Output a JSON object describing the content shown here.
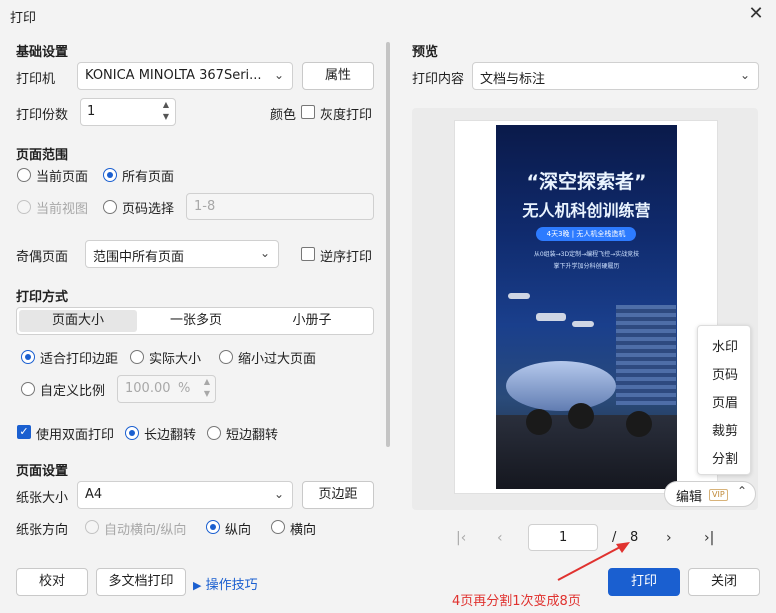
{
  "window": {
    "title": "打印"
  },
  "basic": {
    "section": "基础设置",
    "printer_label": "打印机",
    "printer_value": "KONICA MINOLTA 367Seri...",
    "properties_button": "属性",
    "copies_label": "打印份数",
    "copies_value": "1",
    "color_label": "颜色",
    "grayscale_label": "灰度打印"
  },
  "range": {
    "section": "页面范围",
    "current_page": "当前页面",
    "all_pages": "所有页面",
    "current_view": "当前视图",
    "page_select": "页码选择",
    "page_select_value": "1-8",
    "odd_even_label": "奇偶页面",
    "odd_even_value": "范围中所有页面",
    "reverse_label": "逆序打印"
  },
  "mode": {
    "section": "打印方式",
    "tabs": [
      "页面大小",
      "一张多页",
      "小册子"
    ],
    "fit_margins": "适合打印边距",
    "actual_size": "实际大小",
    "shrink_large": "缩小过大页面",
    "custom_scale": "自定义比例",
    "scale_value": "100.00",
    "scale_unit": "%",
    "duplex": "使用双面打印",
    "long_edge": "长边翻转",
    "short_edge": "短边翻转"
  },
  "page_setup": {
    "section": "页面设置",
    "paper_size_label": "纸张大小",
    "paper_size_value": "A4",
    "margins_button": "页边距",
    "orientation_label": "纸张方向",
    "auto_orientation": "自动横向/纵向",
    "portrait": "纵向",
    "landscape": "横向"
  },
  "footer": {
    "proofread": "校对",
    "multi_doc": "多文档打印",
    "tips": "操作技巧",
    "print": "打印",
    "close": "关闭",
    "annotation": "4页再分割1次变成8页"
  },
  "preview": {
    "section": "预览",
    "content_label": "打印内容",
    "content_value": "文档与标注",
    "poster_title_1": "“深空探索者”",
    "poster_title_2": "无人机科创训练营",
    "poster_band": "4天3晚 | 无人机全栈造机",
    "poster_line_1": "从0组装→3D定制→编程飞控→实战竞技",
    "poster_line_2": "掌下升学加分科创硬履历",
    "context_items": [
      "水印",
      "页码",
      "页眉",
      "裁剪",
      "分割"
    ],
    "edit_label": "编辑",
    "vip_label": "VIP"
  },
  "pager": {
    "current": "1",
    "separator": "/",
    "total": "8"
  },
  "colors": {
    "accent": "#1a5fd0",
    "annotation": "#e0322f"
  }
}
